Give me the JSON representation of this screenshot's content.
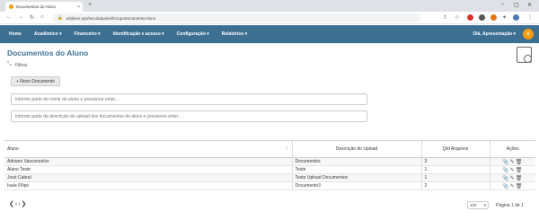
{
  "browser": {
    "tab_title": "Documentos do Aluno",
    "tab_close": "×",
    "new_tab": "+",
    "url": "edulivre.sys/escola/painel/GrupoDocumentoAluno"
  },
  "nav": {
    "items": [
      "Home",
      "Acadêmico ▾",
      "Financeiro ▾",
      "Identificação e acesso ▾",
      "Configuração ▾",
      "Relatórios ▾"
    ],
    "greeting": "Olá, Apresentação ▾",
    "user_initial": "e"
  },
  "page": {
    "title": "Documentos do Aluno",
    "filter_label": "Filtros",
    "new_button": "+ Novo Documento",
    "search_name_placeholder": "Informe parte do nome do aluno e pressione enter...",
    "search_desc_placeholder": "Informe parte da descrição do upload dos documentos do aluno e pressione enter..."
  },
  "table": {
    "columns": [
      "Aluno",
      "Descrição do Upload",
      "Qtd Arquivos",
      "Ações"
    ],
    "rows": [
      {
        "aluno": "Adriano Vasconcelos",
        "descricao": "Documentos",
        "qtd": "3"
      },
      {
        "aluno": "Aluno Teste",
        "descricao": "Teste",
        "qtd": "1"
      },
      {
        "aluno": "José Cabral",
        "descricao": "Teste Upload Documentos",
        "qtd": "1"
      },
      {
        "aluno": "Isaíe Filipe",
        "descricao": "Documento3",
        "qtd": "2"
      }
    ]
  },
  "pager": {
    "nav": "❮‹›❯",
    "page_size": "100",
    "info": "Página 1 de 1"
  },
  "colors": {
    "navbar": "#3d6f93",
    "title": "#3d6f93",
    "user_badge": "#f39c12"
  }
}
